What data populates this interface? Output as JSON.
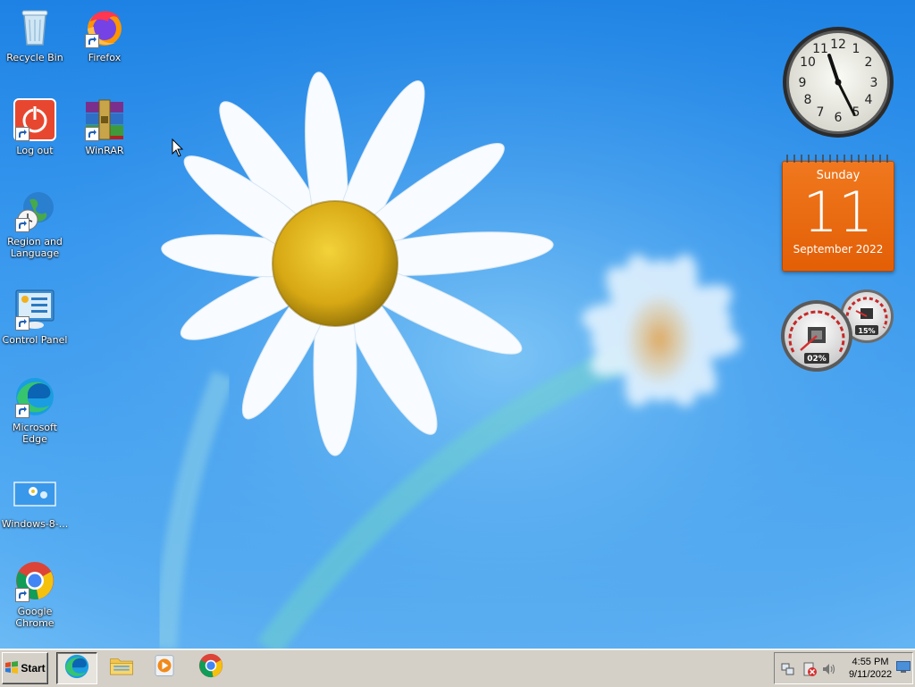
{
  "desktop": {
    "icons": [
      {
        "label": "Recycle Bin",
        "icon": "recycle-bin-icon"
      },
      {
        "label": "Firefox",
        "icon": "firefox-icon"
      },
      {
        "label": "Log out",
        "icon": "power-icon"
      },
      {
        "label": "WinRAR",
        "icon": "winrar-icon"
      },
      {
        "label": "Region and Language",
        "icon": "globe-clock-icon"
      },
      {
        "label": "Control Panel",
        "icon": "control-panel-icon"
      },
      {
        "label": "Microsoft Edge",
        "icon": "edge-icon"
      },
      {
        "label": "Windows-8-...",
        "icon": "image-file-icon"
      },
      {
        "label": "Google Chrome",
        "icon": "chrome-icon"
      }
    ]
  },
  "gadgets": {
    "clock": {
      "hour_markers": [
        "12",
        "1",
        "2",
        "3",
        "4",
        "5",
        "6",
        "7",
        "8",
        "9",
        "10",
        "11"
      ]
    },
    "calendar": {
      "day_name": "Sunday",
      "day_number": "11",
      "month_year": "September 2022"
    },
    "meter": {
      "cpu_percent": "02%",
      "memory_percent": "15%"
    }
  },
  "taskbar": {
    "start_label": "Start",
    "apps": [
      {
        "name": "Microsoft Edge",
        "icon": "edge-icon",
        "active": true
      },
      {
        "name": "File Explorer",
        "icon": "folder-icon",
        "active": false
      },
      {
        "name": "Windows Media Player",
        "icon": "media-player-icon",
        "active": false
      },
      {
        "name": "Google Chrome",
        "icon": "chrome-icon",
        "active": false
      }
    ],
    "tray": {
      "time": "4:55 PM",
      "date": "9/11/2022",
      "icons": [
        "network-icon",
        "security-alert-icon",
        "volume-icon"
      ]
    }
  },
  "colors": {
    "wallpaper_blue": "#2f90ea",
    "calendar_orange": "#e8680f",
    "taskbar_gray": "#d4d0c8"
  }
}
